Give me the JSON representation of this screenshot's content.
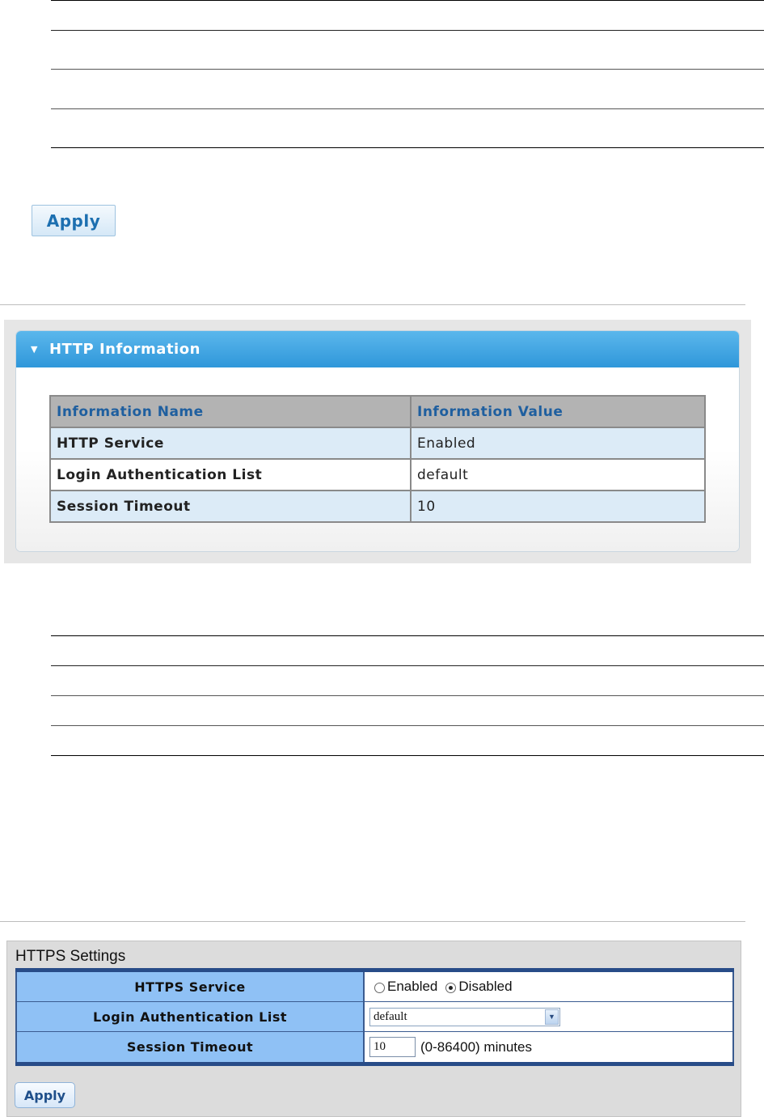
{
  "top_section": {
    "apply_label": "Apply"
  },
  "http_info": {
    "title": "HTTP Information",
    "columns": [
      "Information Name",
      "Information Value"
    ],
    "rows": [
      {
        "name": "HTTP Service",
        "value": "Enabled"
      },
      {
        "name": "Login Authentication List",
        "value": "default"
      },
      {
        "name": "Session Timeout",
        "value": "10"
      }
    ]
  },
  "https_settings": {
    "title": "HTTPS Settings",
    "service": {
      "label": "HTTPS Service",
      "options": [
        "Enabled",
        "Disabled"
      ],
      "selected": "Disabled"
    },
    "login_auth": {
      "label": "Login Authentication List",
      "value": "default"
    },
    "session_timeout": {
      "label": "Session Timeout",
      "value": "10",
      "hint": "(0-86400) minutes"
    },
    "apply_label": "Apply"
  },
  "colors": {
    "header_blue": "#2f97da",
    "label_blue": "#8fc1f5",
    "border_navy": "#284c88"
  }
}
